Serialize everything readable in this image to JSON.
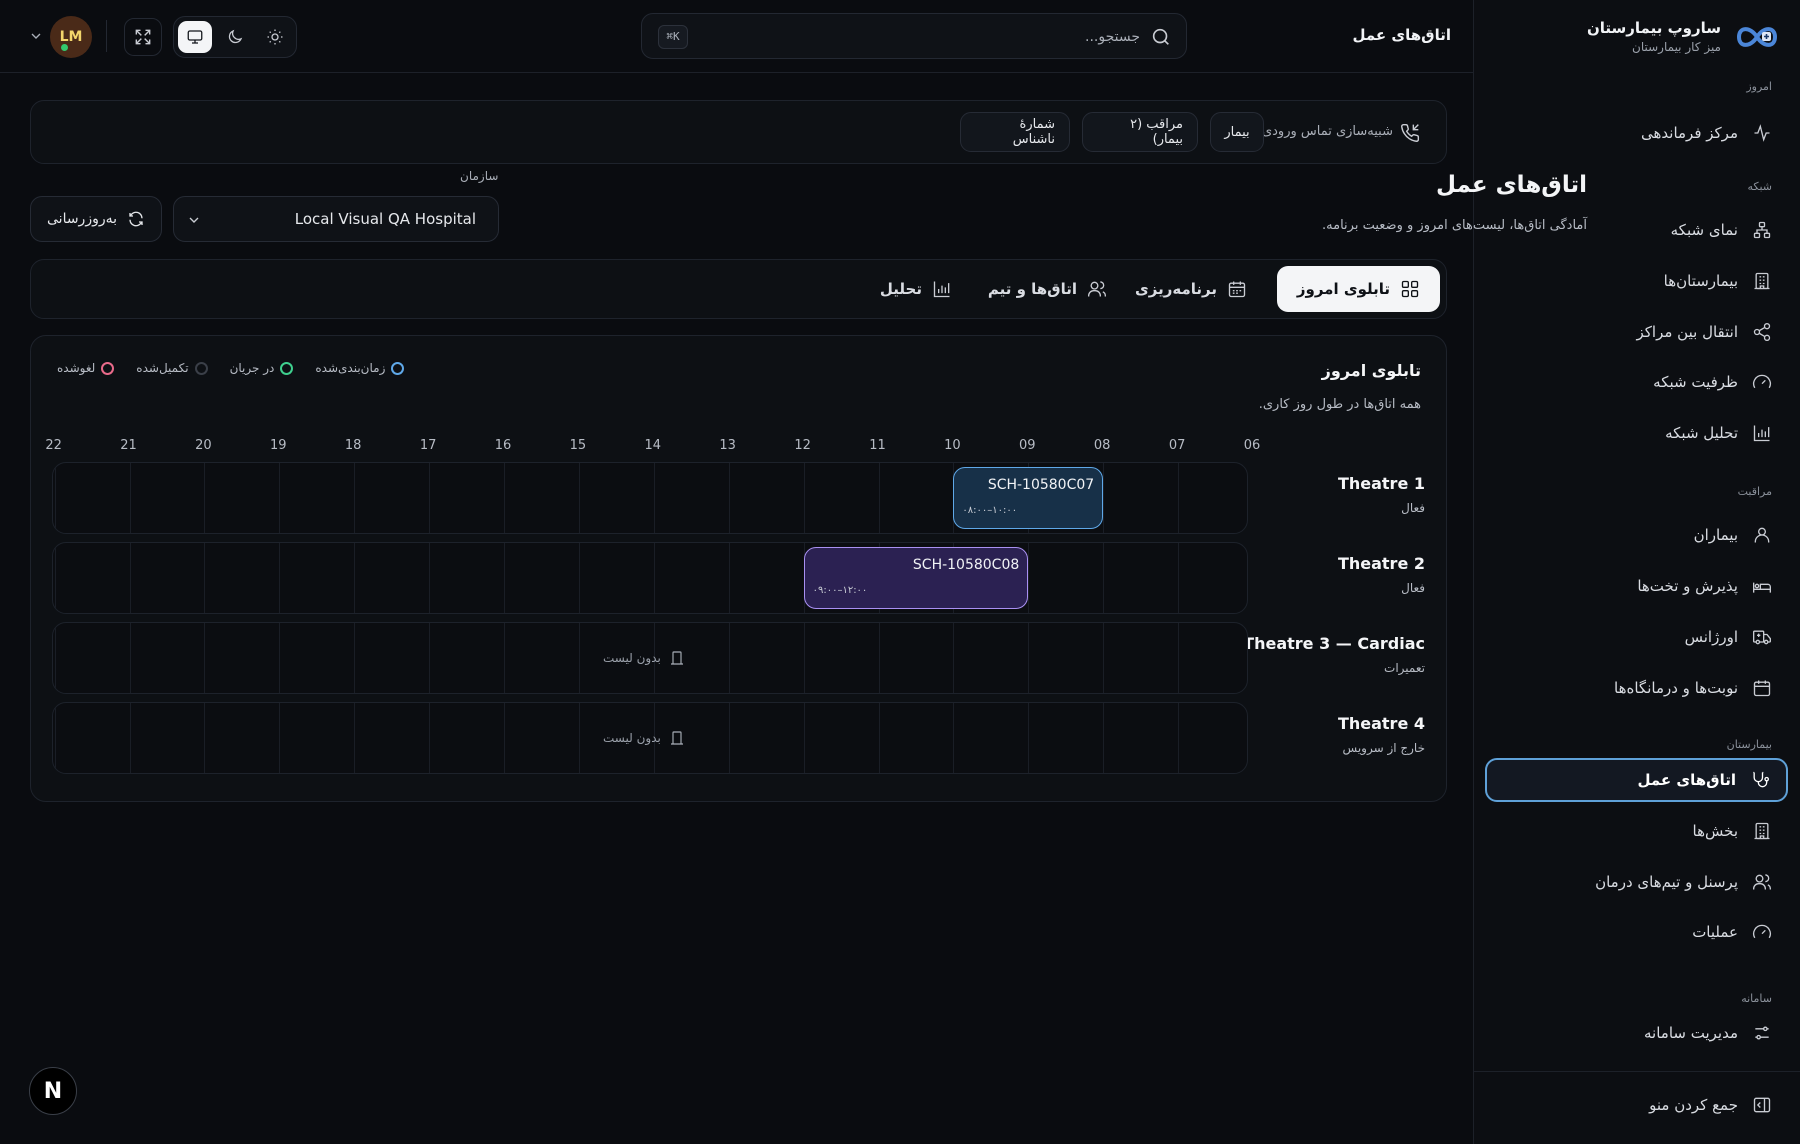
{
  "brand": {
    "title": "ساروپ بیمارستان",
    "subtitle": "میز کار بیمارستان"
  },
  "sidebar": {
    "sections": [
      {
        "label": "امروز",
        "items": [
          {
            "label": "مرکز فرماندهی",
            "icon": "activity-icon"
          }
        ]
      },
      {
        "label": "شبکه",
        "items": [
          {
            "label": "نمای شبکه",
            "icon": "network-icon"
          },
          {
            "label": "بیمارستان‌ها",
            "icon": "building-icon"
          },
          {
            "label": "انتقال بین مراکز",
            "icon": "share-icon"
          },
          {
            "label": "ظرفیت شبکه",
            "icon": "gauge-icon"
          },
          {
            "label": "تحلیل شبکه",
            "icon": "bar-chart-icon"
          }
        ]
      },
      {
        "label": "مراقبت",
        "items": [
          {
            "label": "بیماران",
            "icon": "user-icon"
          },
          {
            "label": "پذیرش و تخت‌ها",
            "icon": "bed-icon"
          },
          {
            "label": "اورژانس",
            "icon": "ambulance-icon"
          },
          {
            "label": "نوبت‌ها و درمانگاه‌ها",
            "icon": "calendar-icon"
          }
        ]
      },
      {
        "label": "بیمارستان",
        "items": [
          {
            "label": "اتاق‌های عمل",
            "icon": "stethoscope-icon",
            "active": true
          },
          {
            "label": "بخش‌ها",
            "icon": "building-icon"
          },
          {
            "label": "پرسنل و تیم‌های درمان",
            "icon": "users-icon"
          },
          {
            "label": "عملیات",
            "icon": "gauge-icon"
          }
        ]
      },
      {
        "label": "سامانه",
        "items": [
          {
            "label": "مدیریت سامانه",
            "icon": "sliders-icon"
          }
        ]
      }
    ],
    "collapse_label": "جمع کردن منو"
  },
  "header": {
    "title": "اتاق‌های عمل",
    "search_placeholder": "جستجو...",
    "search_shortcut": "K⌘",
    "avatar_initials": "LM"
  },
  "call_sim": {
    "label": "شبیه‌سازی تماس ورودی",
    "chips": [
      "بیمار",
      "مراقب (۲ بیمار)",
      "شمارهٔ ناشناس"
    ]
  },
  "page": {
    "title": "اتاق‌های عمل",
    "subtitle": "آمادگی اتاق‌ها، لیست‌های امروز و وضعیت برنامه.",
    "org_label": "سازمان",
    "org_value": "Local Visual QA Hospital",
    "refresh_label": "به‌روزرسانی"
  },
  "tabs": [
    {
      "label": "تابلوی امروز",
      "icon": "grid-icon",
      "active": true
    },
    {
      "label": "برنامه‌ریزی",
      "icon": "calendar-icon"
    },
    {
      "label": "اتاق‌ها و تیم",
      "icon": "users-icon"
    },
    {
      "label": "تحلیل",
      "icon": "bar-chart-icon"
    }
  ],
  "board": {
    "title": "تابلوی امروز",
    "subtitle": "همه اتاق‌ها در طول روز کاری.",
    "legend": [
      {
        "label": "زمان‌بندی‌شده",
        "color": "#5fa8e8"
      },
      {
        "label": "در جریان",
        "color": "#3ecf8e"
      },
      {
        "label": "تکمیل‌شده",
        "color": "#3a3f48"
      },
      {
        "label": "لغوشده",
        "color": "#e86a8a"
      }
    ],
    "hours": [
      "06",
      "07",
      "08",
      "09",
      "10",
      "11",
      "12",
      "13",
      "14",
      "15",
      "16",
      "17",
      "18",
      "19",
      "20",
      "21",
      "22"
    ],
    "rooms": [
      {
        "name": "Theatre 1",
        "status": "فعال",
        "blocks": [
          {
            "code": "SCH-10580C07",
            "time": "۰۸:۰۰–۱۰:۰۰",
            "start": 8,
            "end": 10,
            "color": "#5fa8e8",
            "bg": "#173048"
          }
        ]
      },
      {
        "name": "Theatre 2",
        "status": "فعال",
        "blocks": [
          {
            "code": "SCH-10580C08",
            "time": "۰۹:۰۰–۱۲:۰۰",
            "start": 9,
            "end": 12,
            "color": "#a990f2",
            "bg": "#2b2152"
          }
        ]
      },
      {
        "name": "Theatre 3 — Cardiac",
        "status": "تعمیرات",
        "empty_label": "بدون لیست",
        "blocks": []
      },
      {
        "name": "Theatre 4",
        "status": "خارج از سرویس",
        "empty_label": "بدون لیست",
        "blocks": []
      }
    ]
  }
}
